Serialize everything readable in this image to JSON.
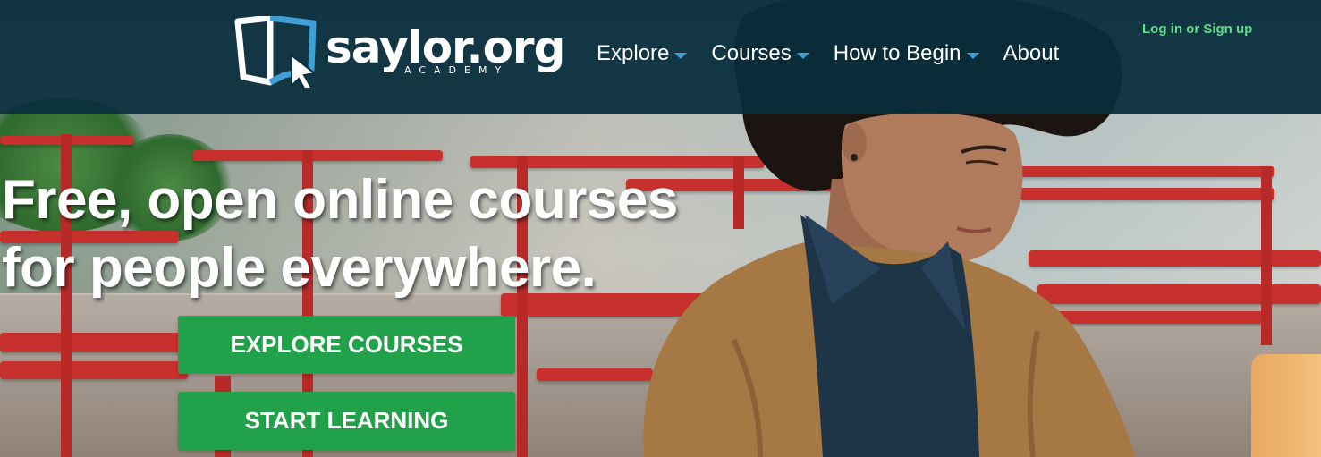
{
  "brand": {
    "name": "saylor.org",
    "subtitle": "ACADEMY"
  },
  "nav": {
    "items": [
      {
        "label": "Explore",
        "has_dropdown": true
      },
      {
        "label": "Courses",
        "has_dropdown": true
      },
      {
        "label": "How to Begin",
        "has_dropdown": true
      },
      {
        "label": "About",
        "has_dropdown": false
      }
    ]
  },
  "auth": {
    "login": "Log in",
    "separator": "or",
    "signup": "Sign up"
  },
  "hero": {
    "headline_line1": "Free, open online courses",
    "headline_line2": "for people everywhere.",
    "explore_button": "EXPLORE COURSES",
    "start_button": "START LEARNING"
  },
  "colors": {
    "header_bg": "#092e3c",
    "button_green": "#21a24a",
    "auth_green": "#5fdc8b",
    "caret_blue": "#3f9fd6",
    "logo_blue": "#3f9fd6"
  },
  "icons": {
    "dropdown": "chevron-down-icon",
    "logo": "saylor-logo-icon"
  }
}
